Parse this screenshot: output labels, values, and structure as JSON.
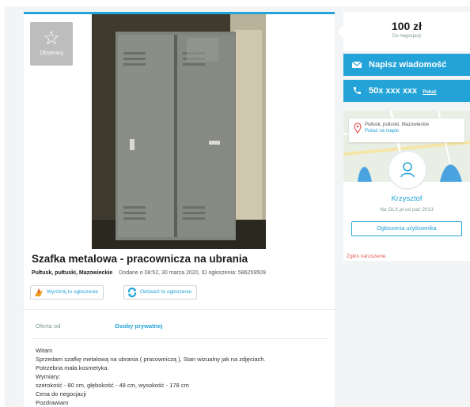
{
  "listing": {
    "observe_label": "Obserwuj",
    "title": "Szafka metalowa - pracownicza na ubrania",
    "location": "Pułtusk, pułtuski, Mazowieckie",
    "added": "Dodane o 08:52, 30 marca 2020, ID ogłoszenia: 586259509",
    "promote_label": "Wyróżnij to ogłoszenie",
    "refresh_label": "Odśwież to ogłoszenie",
    "offer_from_label": "Oferta od",
    "offer_from_value": "Osoby prywatnej",
    "description": [
      "Witam",
      "Sprzedam szafkę metalową na ubrania ( pracowniczą ), Stan wizualny jak na zdjęciach.",
      "Potrzebna mała kosmetyka.",
      "Wymiary:",
      "szerokość - 80 cm, głębokość - 48 cm, wysokość - 178 cm",
      "Cena do negocjacji",
      "Pozdrawiam"
    ]
  },
  "sidebar": {
    "price": "100 zł",
    "negotiable": "Do negocjacji",
    "message_button": "Napisz wiadomość",
    "phone_number": "50x xxx xxx",
    "phone_show": "Pokaż",
    "map_location": "Pułtusk, pułtuski, Mazowieckie",
    "map_link": "Pokaż na mapie",
    "user_name": "Krzysztof",
    "user_since": "Na OLX.pl od paź 2013",
    "user_ads_button": "Ogłoszenia użytkownika",
    "report_link": "Zgłoś naruszenie"
  },
  "colors": {
    "accent": "#23a3d7",
    "report": "#e25a5a"
  }
}
